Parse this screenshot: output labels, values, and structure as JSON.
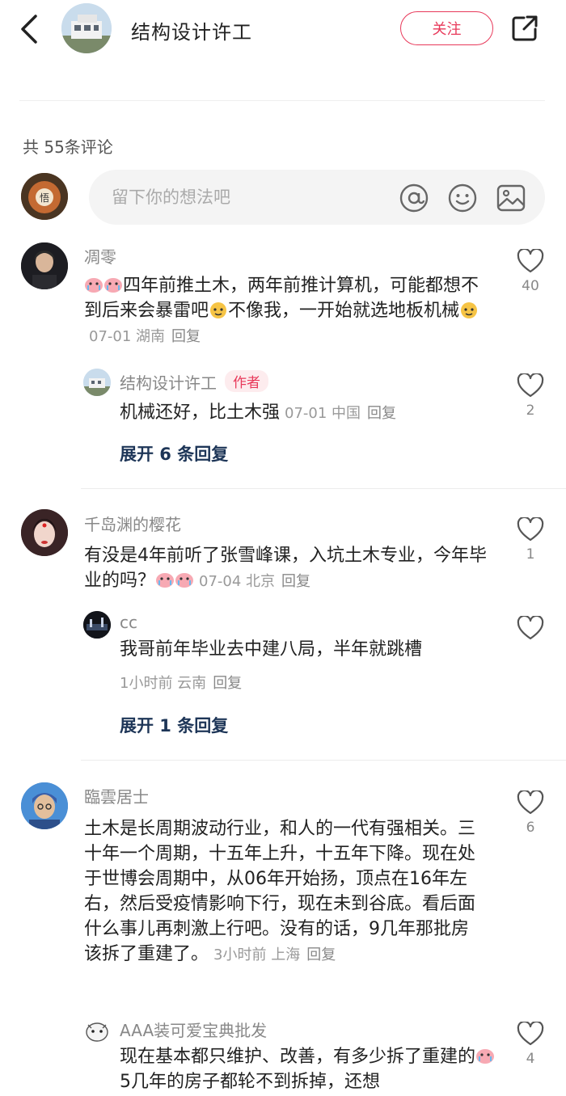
{
  "header": {
    "title": "结构设计许工",
    "follow_label": "关注"
  },
  "comments_count": "共 55条评论",
  "input": {
    "placeholder": "留下你的想法吧"
  },
  "comments": [
    {
      "user": "凋零",
      "text": "四年前推土木，两年前推计算机，可能都想不到后来会暴雷吧",
      "text2": "不像我，一开始就选地板机械",
      "meta": "07-01 湖南",
      "reply": "回复",
      "likes": "40",
      "replies": [
        {
          "user": "结构设计许工",
          "tag": "作者",
          "text": "机械还好，比土木强",
          "meta": "07-01 中国",
          "reply": "回复",
          "likes": "2"
        }
      ],
      "expand": "展开 6 条回复"
    },
    {
      "user": "千岛渊的樱花",
      "text": "有没是4年前听了张雪峰课，入坑土木专业，今年毕业的吗？",
      "meta": "07-04 北京",
      "reply": "回复",
      "likes": "1",
      "replies": [
        {
          "user": "cc",
          "text": "我哥前年毕业去中建八局，半年就跳槽",
          "meta": "1小时前  云南",
          "reply": "回复",
          "likes": ""
        }
      ],
      "expand": "展开 1 条回复"
    },
    {
      "user": "臨雲居士",
      "text": "土木是长周期波动行业，和人的一代有强相关。三十年一个周期，十五年上升，十五年下降。现在处于世博会周期中，从06年开始扬，顶点在16年左右，然后受疫情影响下行，现在未到谷底。看后面什么事儿再刺激上行吧。没有的话，9几年那批房该拆了重建了。",
      "meta": "3小时前  上海",
      "reply": "回复",
      "likes": "6",
      "replies": [
        {
          "user": "AAA装可爱宝典批发",
          "text": "现在基本都只维护、改善，有多少拆了重建的",
          "text2": "5几年的房子都轮不到拆掉，还想",
          "likes": "4"
        }
      ]
    }
  ],
  "colors": {
    "accent": "#e8395a",
    "expand": "#1d3557"
  }
}
